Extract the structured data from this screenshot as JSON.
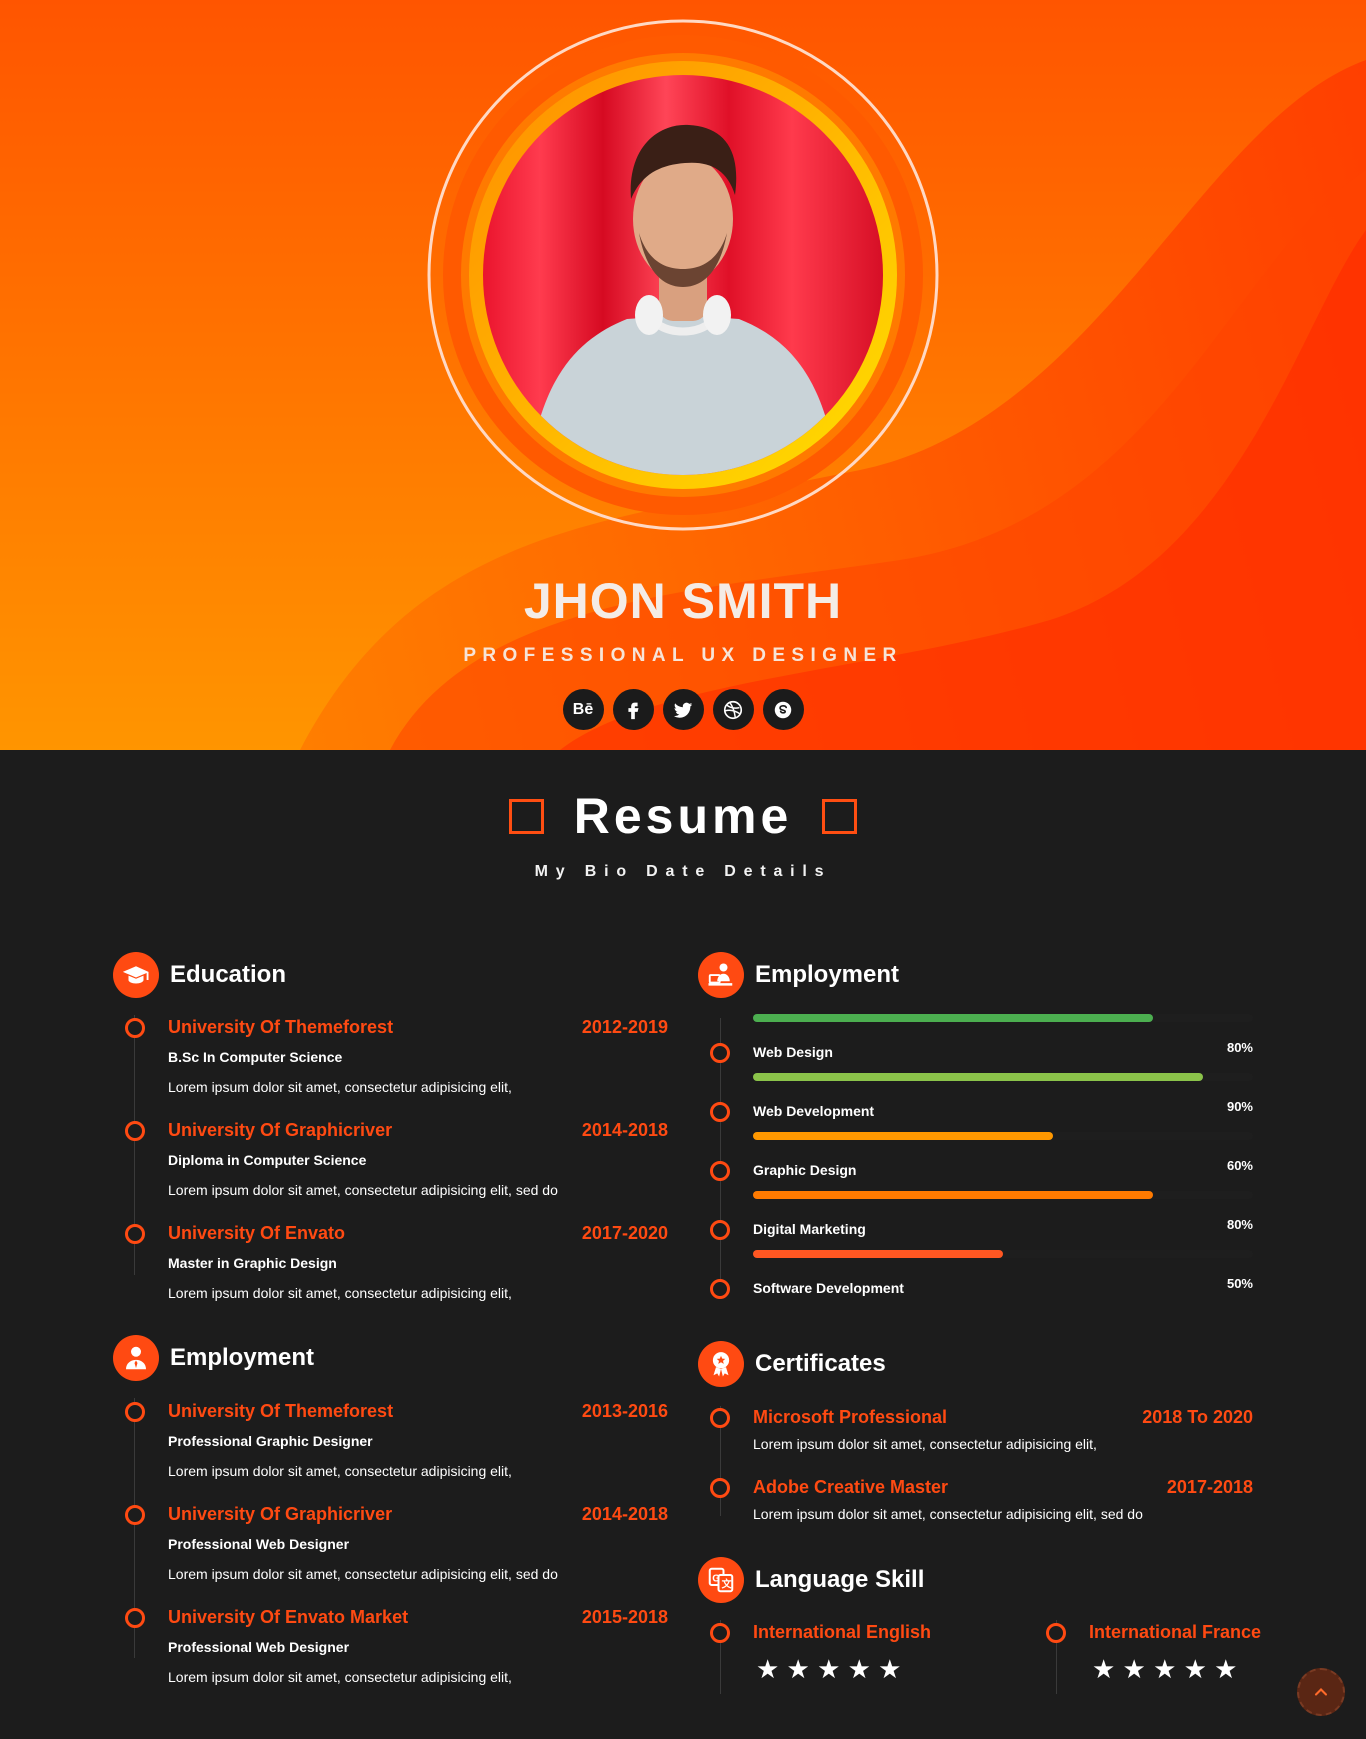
{
  "profile": {
    "name": "JHON SMITH",
    "role": "PROFESSIONAL UX DESIGNER",
    "socials": [
      {
        "label": "Bē",
        "icon": "behance-icon"
      },
      {
        "label": "f",
        "icon": "facebook-icon"
      },
      {
        "label": "",
        "icon": "twitter-icon"
      },
      {
        "label": "",
        "icon": "dribbble-icon"
      },
      {
        "label": "",
        "icon": "skype-icon"
      }
    ]
  },
  "resume": {
    "title": "Resume",
    "subtitle": "My Bio Date Details"
  },
  "education": {
    "heading": "Education",
    "items": [
      {
        "title": "University Of Themeforest",
        "years": "2012-2019",
        "degree": "B.Sc In Computer Science",
        "desc": "Lorem ipsum dolor sit amet, consectetur adipisicing elit,"
      },
      {
        "title": "University Of Graphicriver",
        "years": "2014-2018",
        "degree": "Diploma in Computer Science",
        "desc": "Lorem ipsum dolor sit amet, consectetur adipisicing elit, sed do"
      },
      {
        "title": "University Of Envato",
        "years": "2017-2020",
        "degree": "Master in Graphic Design",
        "desc": "Lorem ipsum dolor sit amet, consectetur adipisicing elit,"
      }
    ]
  },
  "employment_history": {
    "heading": "Employment",
    "items": [
      {
        "title": "University Of Themeforest",
        "years": "2013-2016",
        "degree": "Professional Graphic Designer",
        "desc": "Lorem ipsum dolor sit amet, consectetur adipisicing elit,"
      },
      {
        "title": "University Of Graphicriver",
        "years": "2014-2018",
        "degree": "Professional Web Designer",
        "desc": "Lorem ipsum dolor sit amet, consectetur adipisicing elit, sed do"
      },
      {
        "title": "University Of Envato Market",
        "years": "2015-2018",
        "degree": "Professional Web Designer",
        "desc": "Lorem ipsum dolor sit amet, consectetur adipisicing elit,"
      }
    ]
  },
  "skills": {
    "heading": "Employment",
    "items": [
      {
        "label": "Web Design",
        "percent_text": "80%",
        "value": 0.8,
        "color": "#4caf50"
      },
      {
        "label": "Web Development",
        "percent_text": "90%",
        "value": 0.9,
        "color": "#8bc34a"
      },
      {
        "label": "Graphic Design",
        "percent_text": "60%",
        "value": 0.6,
        "color": "#ff9800"
      },
      {
        "label": "Digital Marketing",
        "percent_text": "80%",
        "value": 0.8,
        "color": "#ff7a00"
      },
      {
        "label": "Software Development",
        "percent_text": "50%",
        "value": 0.5,
        "color": "#ff5722"
      }
    ]
  },
  "certificates": {
    "heading": "Certificates",
    "items": [
      {
        "title": "Microsoft Professional",
        "years": "2018 To 2020",
        "desc": "Lorem ipsum dolor sit amet, consectetur adipisicing elit,"
      },
      {
        "title": "Adobe Creative Master",
        "years": "2017-2018",
        "desc": "Lorem ipsum dolor sit amet, consectetur adipisicing elit, sed do"
      }
    ]
  },
  "languages": {
    "heading": "Language Skill",
    "items": [
      {
        "title": "International English",
        "rating": 5,
        "stars": "★ ★ ★ ★ ★"
      },
      {
        "title": "International France",
        "rating": 5,
        "stars": "★ ★ ★ ★ ★"
      }
    ]
  },
  "colors": {
    "accent": "#ff4a12",
    "dark_bg": "#1c1c1c"
  }
}
